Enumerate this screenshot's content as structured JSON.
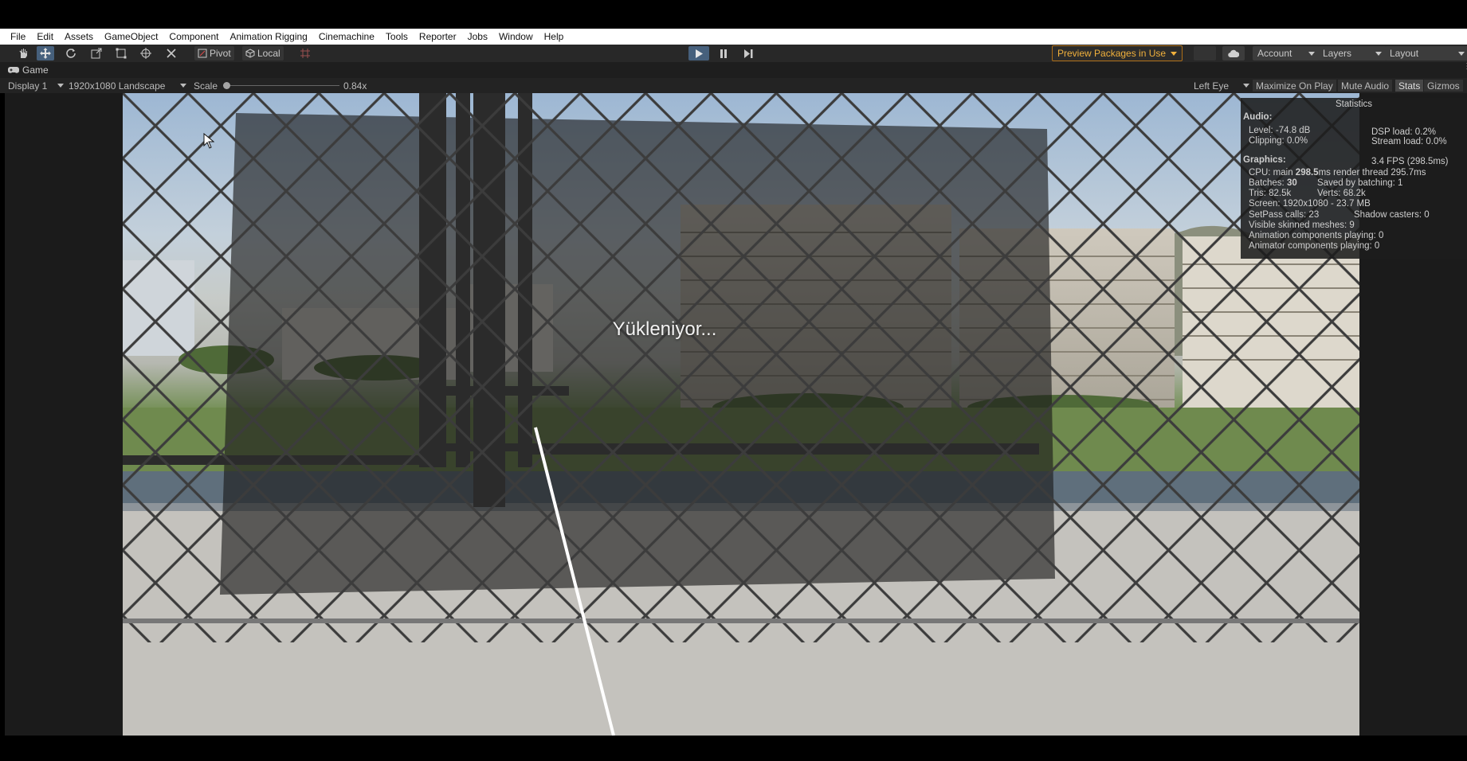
{
  "menu": [
    "File",
    "Edit",
    "Assets",
    "GameObject",
    "Component",
    "Animation Rigging",
    "Cinemachine",
    "Tools",
    "Reporter",
    "Jobs",
    "Window",
    "Help"
  ],
  "toolbar": {
    "pivot_label": "Pivot",
    "local_label": "Local",
    "preview_packages_label": "Preview Packages in Use",
    "account_label": "Account",
    "layers_label": "Layers",
    "layout_label": "Layout"
  },
  "game_tab": {
    "label": "Game"
  },
  "game_bar": {
    "display": "Display 1",
    "resolution": "1920x1080 Landscape",
    "scale_label": "Scale",
    "scale_value": "0.84x",
    "eye": "Left Eye",
    "maximize": "Maximize On Play",
    "mute": "Mute Audio",
    "stats": "Stats",
    "gizmos": "Gizmos"
  },
  "game_view": {
    "loading_text": "Yükleniyor..."
  },
  "stats_panel": {
    "title": "Statistics",
    "audio_header": "Audio:",
    "level": "Level: -74.8 dB",
    "clipping": "Clipping: 0.0%",
    "dsp": "DSP load: 0.2%",
    "stream": "Stream load: 0.0%",
    "graphics_header": "Graphics:",
    "fps": "3.4 FPS (298.5ms)",
    "cpu_prefix": "CPU: main ",
    "cpu_main": "298.5",
    "cpu_suffix": "ms  render thread 295.7ms",
    "batches_prefix": "Batches: ",
    "batches_value": "30",
    "saved": "Saved by batching: 1",
    "tris": "Tris: 82.5k",
    "verts": "Verts: 68.2k",
    "screen": "Screen: 1920x1080 - 23.7 MB",
    "setpass": "SetPass calls: 23",
    "shadow": "Shadow casters: 0",
    "skinned": "Visible skinned meshes: 9",
    "anim": "Animation components playing: 0",
    "animator": "Animator components playing: 0"
  },
  "colors": {
    "accent": "#46607c",
    "warning": "#f0b03c",
    "toolbar_bg": "#282828"
  }
}
